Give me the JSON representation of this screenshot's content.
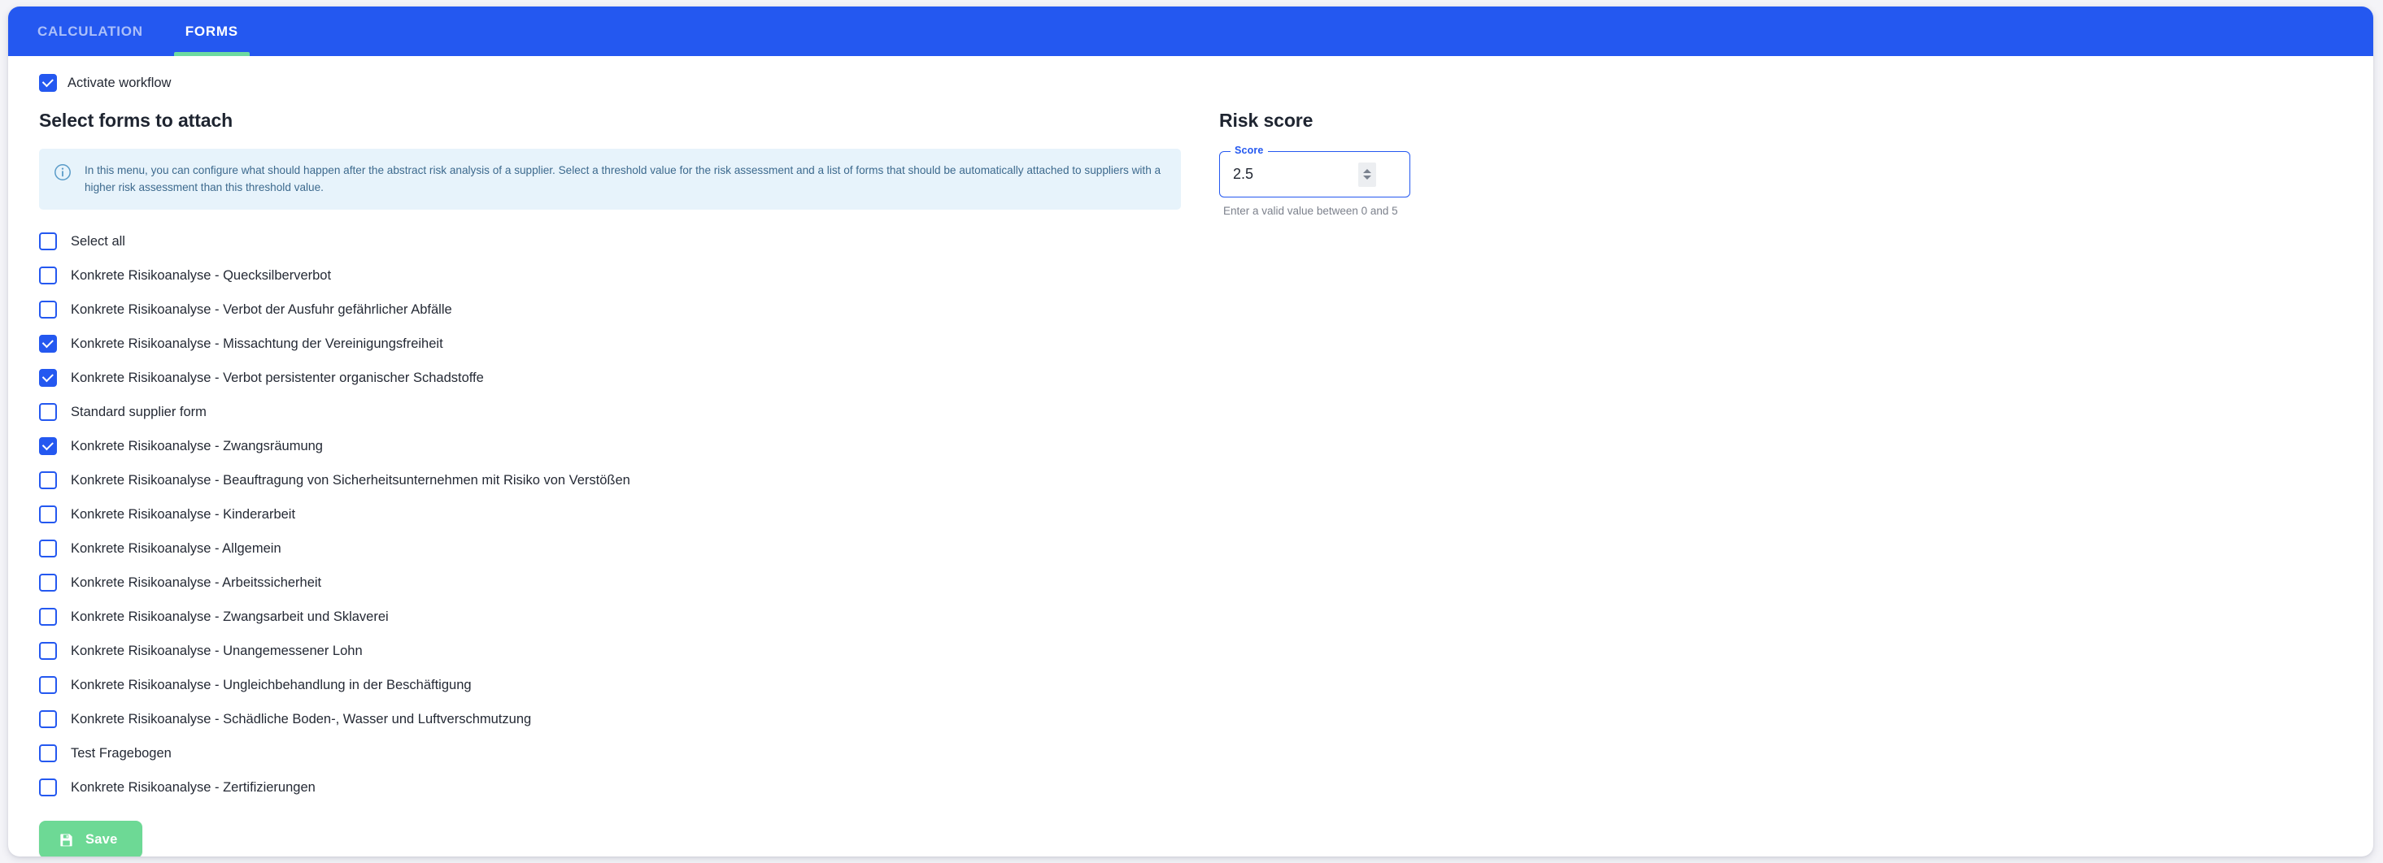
{
  "tabs": [
    {
      "label": "CALCULATION",
      "active": false
    },
    {
      "label": "FORMS",
      "active": true
    }
  ],
  "activate_workflow": {
    "label": "Activate workflow",
    "checked": true
  },
  "left_panel": {
    "title": "Select forms to attach",
    "info": {
      "icon": "info-circle-icon",
      "text": "In this menu, you can configure what should happen after the abstract risk analysis of a supplier. Select a threshold value for the risk assessment and a list of forms that should be automatically attached to suppliers with a higher risk assessment than this threshold value."
    },
    "forms": [
      {
        "label": "Select all",
        "checked": false
      },
      {
        "label": "Konkrete Risikoanalyse - Quecksilberverbot",
        "checked": false
      },
      {
        "label": "Konkrete Risikoanalyse - Verbot der Ausfuhr gefährlicher Abfälle",
        "checked": false
      },
      {
        "label": "Konkrete Risikoanalyse - Missachtung der Vereinigungsfreiheit",
        "checked": true
      },
      {
        "label": "Konkrete Risikoanalyse - Verbot persistenter organischer Schadstoffe",
        "checked": true
      },
      {
        "label": "Standard supplier form",
        "checked": false
      },
      {
        "label": "Konkrete Risikoanalyse - Zwangsräumung",
        "checked": true
      },
      {
        "label": "Konkrete Risikoanalyse - Beauftragung von Sicherheitsunternehmen mit Risiko von Verstößen",
        "checked": false
      },
      {
        "label": "Konkrete Risikoanalyse - Kinderarbeit",
        "checked": false
      },
      {
        "label": "Konkrete Risikoanalyse - Allgemein",
        "checked": false
      },
      {
        "label": "Konkrete Risikoanalyse - Arbeitssicherheit",
        "checked": false
      },
      {
        "label": "Konkrete Risikoanalyse - Zwangsarbeit und Sklaverei",
        "checked": false
      },
      {
        "label": "Konkrete Risikoanalyse - Unangemessener Lohn",
        "checked": false
      },
      {
        "label": "Konkrete Risikoanalyse - Ungleichbehandlung in der Beschäftigung",
        "checked": false
      },
      {
        "label": "Konkrete Risikoanalyse - Schädliche Boden-, Wasser und Luftverschmutzung",
        "checked": false
      },
      {
        "label": "Test Fragebogen",
        "checked": false
      },
      {
        "label": "Konkrete Risikoanalyse - Zertifizierungen",
        "checked": false
      }
    ],
    "save_button": {
      "label": "Save",
      "icon": "save-floppy-icon"
    }
  },
  "right_panel": {
    "title": "Risk score",
    "score_field": {
      "legend": "Score",
      "value": "2.5",
      "placeholder": "",
      "spinner_icon": "spinner-up-down-icon"
    },
    "helper_text": "Enter a valid value between 0 and 5"
  },
  "colors": {
    "tab_bar": "#2458f0",
    "tab_active_underline": "#6ddaa0",
    "checkbox_accent": "#2458f0",
    "save_button": "#6dd995",
    "info_box_bg": "#e7f3fb",
    "info_text": "#3d6a8e",
    "field_border": "#2458f0",
    "page_bg": "#f4f4f8"
  }
}
